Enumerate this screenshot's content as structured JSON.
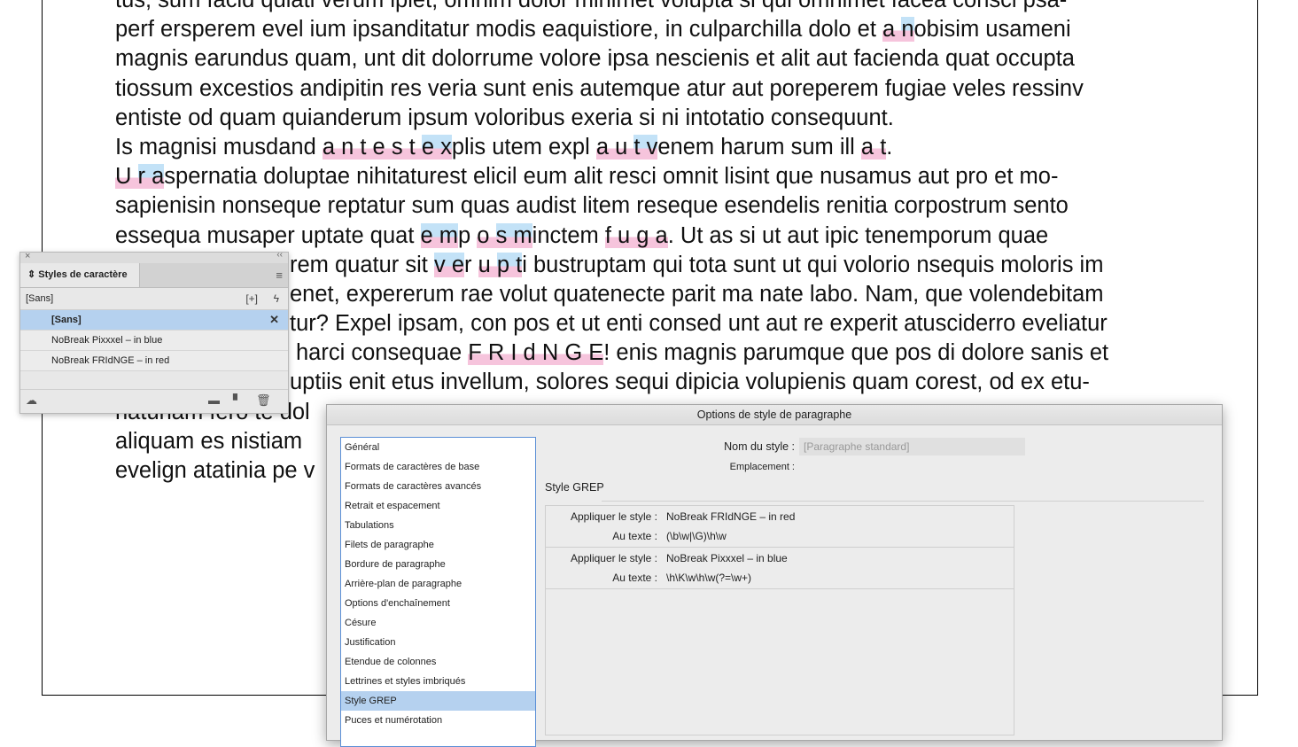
{
  "document": {
    "lines": [
      "tus, sum facid quiati verum ipiet, omnim dolor minimet volupta si qui omnimet facea consci psa-",
      "perf ersperem evel ium ipsanditatur modis eaquistiore, in culparchilla dolo et a nobisim usameni",
      "magnis earundus quam, unt dit dolorrume volore ipsa nescienis et alit aut facienda quat occupta",
      "tiossum excestios andipitin res veria sunt enis autemque atur aut poreperem fugiae veles ressinv",
      "entiste od quam quianderum ipsum voloribus exeria si ni intotatio consequunt.",
      "Is magnisi musdand a n t e s t e xplis utem expl a u t venem harum sum ill a t.",
      "U r aspernatia doluptae nihitaturest elicil eum alit resci omnit lisint que nusamus aut pro et mo-",
      "sapienisin nonseque reptatur sum quas audist litem reseque esendelis renitia corpostrum sento",
      "essequa musaper uptate quat e mp o s minctem f u g a. Ut as si ut aut ipic tenemporum quae",
      "rem quatur sit v er u p ti bustruptam qui tota sunt ut qui volorio nsequis moloris im",
      "enet, expererum rae volut quatenecte parit ma nate labo. Nam, que volendebitam",
      "tur? Expel ipsam, con pos et ut enti consed unt aut re experit atusciderro eveliatur",
      "harci consequae F R I d N G E! enis magnis parumque que pos di dolore sanis et",
      "uptiis enit etus invellum, solores sequi dipicia volupienis quam corest, od ex etu-",
      "natunam fero te dol",
      "aliquam es nistiam",
      "evelign atatinia pe v"
    ]
  },
  "char_panel": {
    "tab_label": "Styles de caractère",
    "header_label": "[Sans]",
    "items": [
      {
        "label": "[Sans]",
        "selected": true
      },
      {
        "label": "NoBreak Pixxxel – in blue",
        "selected": false
      },
      {
        "label": "NoBreak FRIdNGE – in red",
        "selected": false
      }
    ]
  },
  "dialog": {
    "title": "Options de style de paragraphe",
    "categories": [
      {
        "label": "Général",
        "selected": false
      },
      {
        "label": "Formats de caractères de base",
        "selected": false
      },
      {
        "label": "Formats de caractères avancés",
        "selected": false
      },
      {
        "label": "Retrait et espacement",
        "selected": false
      },
      {
        "label": "Tabulations",
        "selected": false
      },
      {
        "label": "Filets de paragraphe",
        "selected": false
      },
      {
        "label": "Bordure de paragraphe",
        "selected": false
      },
      {
        "label": "Arrière-plan de paragraphe",
        "selected": false
      },
      {
        "label": "Options d'enchaînement",
        "selected": false
      },
      {
        "label": "Césure",
        "selected": false
      },
      {
        "label": "Justification",
        "selected": false
      },
      {
        "label": "Etendue de colonnes",
        "selected": false
      },
      {
        "label": "Lettrines et styles imbriqués",
        "selected": false
      },
      {
        "label": "Style GREP",
        "selected": true
      },
      {
        "label": "Puces et numérotation",
        "selected": false
      }
    ],
    "style_name_label": "Nom du style :",
    "style_name_value": "[Paragraphe standard]",
    "location_label": "Emplacement :",
    "section_heading": "Style GREP",
    "grep_rules": [
      {
        "apply_label": "Appliquer le style :",
        "apply_value": "NoBreak FRIdNGE – in red",
        "text_label": "Au texte :",
        "text_value": "(\\b\\w|\\G)\\h\\w"
      },
      {
        "apply_label": "Appliquer le style :",
        "apply_value": "NoBreak Pixxxel – in blue",
        "text_label": "Au texte :",
        "text_value": "\\h\\K\\w\\h\\w(?=\\w+)"
      }
    ]
  },
  "colors": {
    "highlight_pink": "#f6c4dc",
    "highlight_blue": "#c3e2f7",
    "selection_blue": "#b5d1ef"
  }
}
